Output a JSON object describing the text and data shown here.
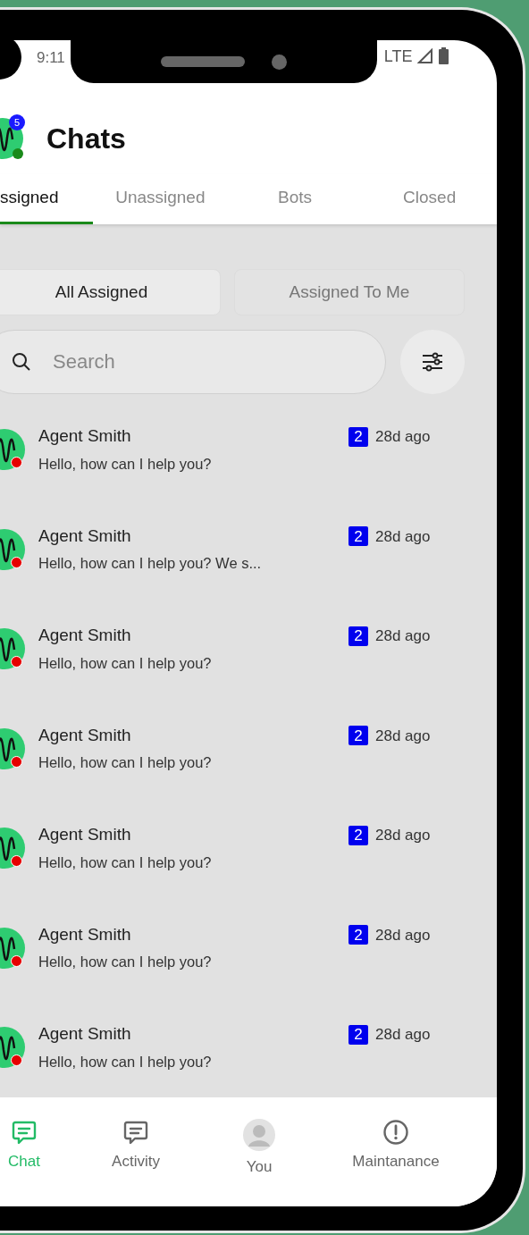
{
  "status_bar": {
    "time": "9:11",
    "network": "LTE"
  },
  "header": {
    "title": "Chats",
    "badge": "5",
    "online": true
  },
  "tabs": [
    {
      "label": "ssigned",
      "selected": true
    },
    {
      "label": "Unassigned",
      "selected": false
    },
    {
      "label": "Bots",
      "selected": false
    },
    {
      "label": "Closed",
      "selected": false
    }
  ],
  "segments": [
    {
      "label": "All Assigned",
      "selected": true
    },
    {
      "label": "Assigned To Me",
      "selected": false
    }
  ],
  "search": {
    "placeholder": "Search"
  },
  "chats": [
    {
      "name": "Agent Smith",
      "message": "Hello, how can I help you?",
      "unread": "2",
      "time": "28d ago"
    },
    {
      "name": "Agent Smith",
      "message": "Hello, how can I help you? We s...",
      "unread": "2",
      "time": "28d ago"
    },
    {
      "name": "Agent Smith",
      "message": "Hello, how can I help you?",
      "unread": "2",
      "time": "28d ago"
    },
    {
      "name": "Agent Smith",
      "message": "Hello, how can I help you?",
      "unread": "2",
      "time": "28d ago"
    },
    {
      "name": "Agent Smith",
      "message": "Hello, how can I help you?",
      "unread": "2",
      "time": "28d ago"
    },
    {
      "name": "Agent Smith",
      "message": "Hello, how can I help you?",
      "unread": "2",
      "time": "28d ago"
    },
    {
      "name": "Agent Smith",
      "message": "Hello, how can I help you?",
      "unread": "2",
      "time": "28d ago"
    }
  ],
  "bottom_nav": [
    {
      "label": "Chat",
      "kind": "chat",
      "selected": true
    },
    {
      "label": "Activity",
      "kind": "chat",
      "selected": false
    },
    {
      "label": "You",
      "kind": "profile",
      "selected": false
    },
    {
      "label": "Maintanance",
      "kind": "alert",
      "selected": false
    }
  ]
}
